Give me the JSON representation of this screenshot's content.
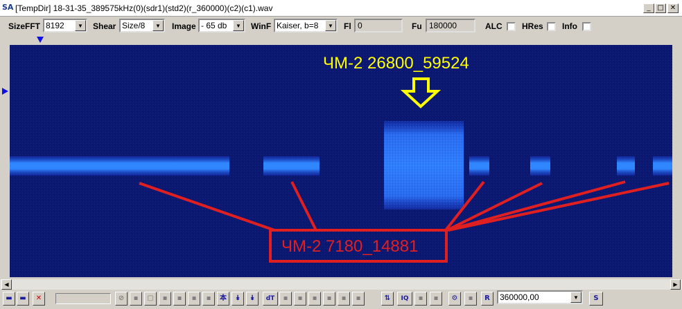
{
  "window": {
    "title": "[TempDir] 18-31-35_389575kHz(0)(sdr1)(std2)(r_360000)(c2)(c1).wav",
    "icon_label": "SA",
    "buttons": {
      "minimize": "_",
      "maximize": "□",
      "close": "✕"
    }
  },
  "toolbar": {
    "sizefft": {
      "label": "SizeFFT",
      "value": "8192"
    },
    "shear": {
      "label": "Shear",
      "value": "Size/8"
    },
    "image": {
      "label": "Image",
      "value": "- 65 db"
    },
    "winf": {
      "label": "WinF",
      "value": "Kaiser, b=8"
    },
    "fl": {
      "label": "Fl",
      "value": "0"
    },
    "fu": {
      "label": "Fu",
      "value": "180000"
    },
    "alc": {
      "label": "ALC",
      "checked": false
    },
    "hres": {
      "label": "HRes",
      "checked": false
    },
    "info": {
      "label": "Info",
      "checked": false
    }
  },
  "annotations": {
    "top_label": "ЧМ-2 26800_59524",
    "top_color": "#ffff00",
    "bottom_label": "ЧМ-2 7180_14881",
    "bottom_color": "#e02020"
  },
  "colors": {
    "spectrogram_bg": "#0c1770",
    "signal": "#2a7cff",
    "marker": "#1010e0"
  },
  "bottombar": {
    "rate_value": "360000,00",
    "buttons": [
      {
        "name": "save-icon",
        "glyph": "▬"
      },
      {
        "name": "open-icon",
        "glyph": "▬"
      },
      {
        "name": "delete-icon",
        "glyph": "✕"
      },
      {
        "name": "stop-icon",
        "glyph": "⊘"
      },
      {
        "name": "tool-1-icon",
        "glyph": "▪"
      },
      {
        "name": "tool-2-icon",
        "glyph": "▢"
      },
      {
        "name": "tool-3-icon",
        "glyph": "▪"
      },
      {
        "name": "tool-4-icon",
        "glyph": "▪"
      },
      {
        "name": "tool-5-icon",
        "glyph": "▪"
      },
      {
        "name": "tool-6-icon",
        "glyph": "▪"
      },
      {
        "name": "tool-7-icon",
        "glyph": "本"
      },
      {
        "name": "tool-8-icon",
        "glyph": "⯯"
      },
      {
        "name": "tool-9-icon",
        "glyph": "⯯"
      },
      {
        "name": "dt-icon",
        "glyph": "dT"
      },
      {
        "name": "tool-10-icon",
        "glyph": "▪"
      },
      {
        "name": "tool-11-icon",
        "glyph": "▪"
      },
      {
        "name": "tool-12-icon",
        "glyph": "▪"
      },
      {
        "name": "tool-13-icon",
        "glyph": "▪"
      },
      {
        "name": "tool-14-icon",
        "glyph": "▪"
      },
      {
        "name": "tool-15-icon",
        "glyph": "▪"
      },
      {
        "name": "swap-icon",
        "glyph": "⇅"
      },
      {
        "name": "iq-icon",
        "glyph": "IQ"
      },
      {
        "name": "tool-16-icon",
        "glyph": "▪"
      },
      {
        "name": "tool-17-icon",
        "glyph": "▪"
      },
      {
        "name": "settings-icon",
        "glyph": "⚙"
      },
      {
        "name": "tool-18-icon",
        "glyph": "▪"
      },
      {
        "name": "r-icon",
        "glyph": "R"
      }
    ],
    "s_label": "S"
  }
}
